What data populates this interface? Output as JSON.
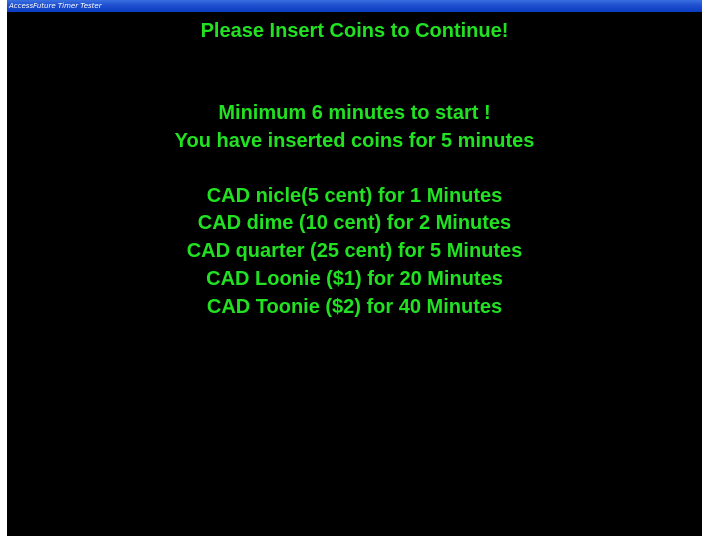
{
  "window": {
    "title": "AccessFuture Timer Tester"
  },
  "screen": {
    "text_color": "#22e022",
    "background_color": "#000000",
    "heading": "Please Insert Coins to Continue!",
    "minimum_message": "Minimum 6 minutes to start !",
    "inserted_message": "You have inserted coins for 5 minutes",
    "rates": [
      "CAD nicle(5 cent) for 1 Minutes",
      "CAD dime (10 cent) for 2 Minutes",
      "CAD quarter (25 cent) for 5 Minutes",
      "CAD Loonie ($1) for 20 Minutes",
      "CAD Toonie ($2) for 40 Minutes"
    ]
  }
}
